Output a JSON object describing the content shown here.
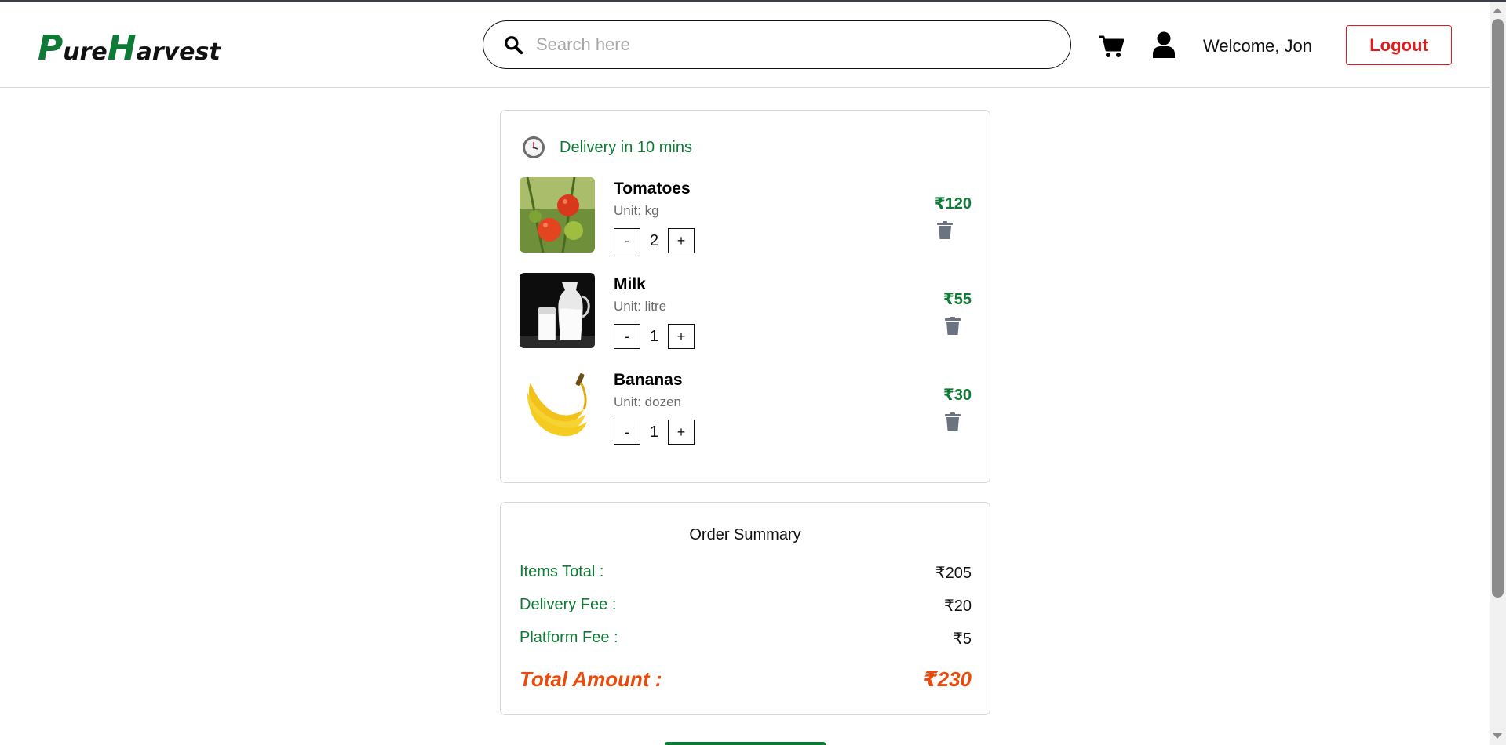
{
  "header": {
    "logo": {
      "p": "P",
      "ure": "ure",
      "h": "H",
      "arvest": "arvest"
    },
    "search": {
      "placeholder": "Search here",
      "value": ""
    },
    "icons": {
      "search": "search-icon",
      "cart": "cart-icon",
      "user": "user-icon"
    },
    "welcome": "Welcome, Jon",
    "logout_label": "Logout"
  },
  "cart": {
    "delivery_text": "Delivery in 10 mins",
    "items": [
      {
        "name": "Tomatoes",
        "unit": "Unit: kg",
        "quantity": "2",
        "price": "₹120",
        "minus": "-",
        "plus": "+"
      },
      {
        "name": "Milk",
        "unit": "Unit: litre",
        "quantity": "1",
        "price": "₹55",
        "minus": "-",
        "plus": "+"
      },
      {
        "name": "Bananas",
        "unit": "Unit: dozen",
        "quantity": "1",
        "price": "₹30",
        "minus": "-",
        "plus": "+"
      }
    ]
  },
  "summary": {
    "title": "Order Summary",
    "items_total_label": "Items Total :",
    "items_total_value": "₹205",
    "delivery_fee_label": "Delivery Fee :",
    "delivery_fee_value": "₹20",
    "platform_fee_label": "Platform Fee :",
    "platform_fee_value": "₹5",
    "total_label": "Total Amount :",
    "total_value": "₹230"
  },
  "colors": {
    "brand_green": "#0f7a35",
    "logout_red": "#e11b1b",
    "total_orange": "#ea4a0c",
    "muted_text": "#6b6b6b"
  }
}
